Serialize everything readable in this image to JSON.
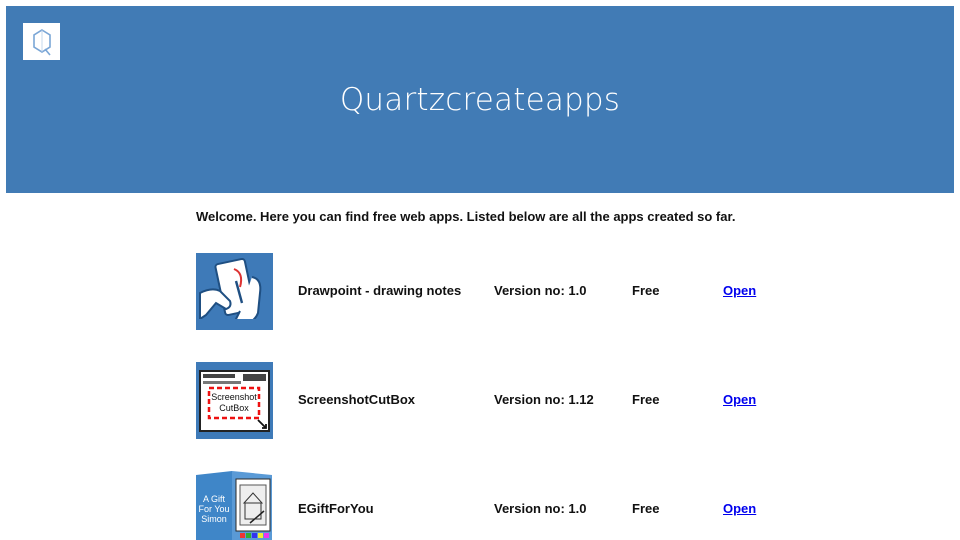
{
  "header": {
    "title": "Quartzcreateapps",
    "logo_icon": "quartz-logo-icon",
    "background": "#417bb5"
  },
  "intro": {
    "text": "Welcome. Here you can find free web apps. Listed below are all the apps created so far."
  },
  "apps": [
    {
      "name": "Drawpoint - drawing notes",
      "version": "Version no: 1.0",
      "price": "Free",
      "link": "Open",
      "icon": "drawing-hand-icon"
    },
    {
      "name": "ScreenshotCutBox",
      "version": "Version no: 1.12",
      "price": "Free",
      "link": "Open",
      "icon": "screenshot-box-icon",
      "icon_text": [
        "Screenshot",
        "CutBox"
      ]
    },
    {
      "name": "EGiftForYou",
      "version": "Version no: 1.0",
      "price": "Free",
      "link": "Open",
      "icon": "gift-card-icon",
      "icon_text": [
        "A Gift",
        "For You",
        "Simon"
      ]
    }
  ],
  "colors": {
    "link": "#0000ee",
    "header": "#417bb5"
  }
}
